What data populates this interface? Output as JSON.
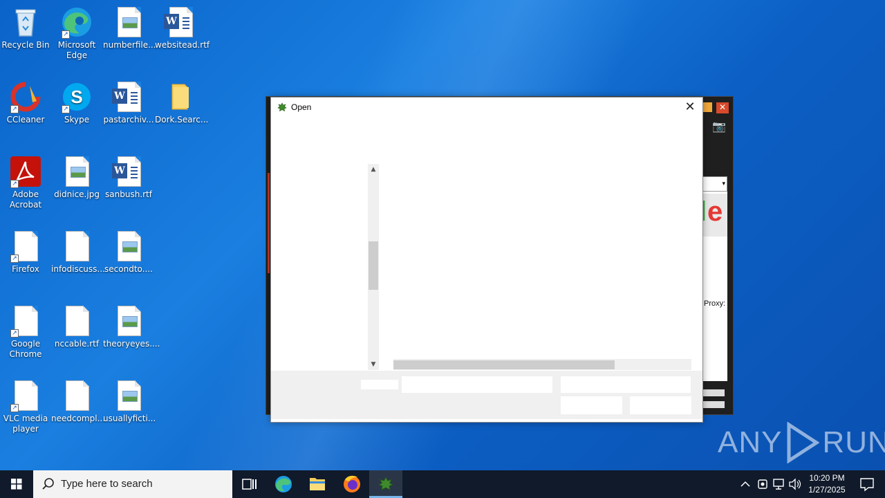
{
  "desktop": {
    "icons": [
      {
        "label": "Recycle Bin",
        "icon": "recycle-bin-icon"
      },
      {
        "label": "Microsoft Edge",
        "icon": "edge-icon"
      },
      {
        "label": "numberfile...",
        "icon": "image-file-icon"
      },
      {
        "label": "websitead.rtf",
        "icon": "word-doc-icon"
      },
      {
        "label": "CCleaner",
        "icon": "ccleaner-icon"
      },
      {
        "label": "Skype",
        "icon": "skype-icon"
      },
      {
        "label": "pastarchiv...",
        "icon": "word-doc-icon"
      },
      {
        "label": "Dork.Searc...",
        "icon": "folder-icon"
      },
      {
        "label": "Adobe Acrobat",
        "icon": "acrobat-icon"
      },
      {
        "label": "didnice.jpg",
        "icon": "image-file-icon"
      },
      {
        "label": "sanbush.rtf",
        "icon": "word-doc-icon"
      },
      {
        "label": "Firefox",
        "icon": "blank-file-icon"
      },
      {
        "label": "infodiscuss...",
        "icon": "blank-file-icon"
      },
      {
        "label": "secondto....",
        "icon": "image-file-icon"
      },
      {
        "label": "Google Chrome",
        "icon": "blank-file-icon"
      },
      {
        "label": "nccable.rtf",
        "icon": "blank-file-icon"
      },
      {
        "label": "theoryeyes....",
        "icon": "image-file-icon"
      },
      {
        "label": "VLC media player",
        "icon": "blank-file-icon"
      },
      {
        "label": "needcompl...",
        "icon": "blank-file-icon"
      },
      {
        "label": "usuallyficti...",
        "icon": "image-file-icon"
      }
    ]
  },
  "background_app": {
    "proxy_label": "Proxy:"
  },
  "dialog": {
    "title": "Open",
    "close_glyph": "✕"
  },
  "watermark": {
    "left": "ANY",
    "right": "RUN"
  },
  "taskbar": {
    "search_placeholder": "Type here to search",
    "time": "10:20 PM",
    "date": "1/27/2025"
  },
  "colors": {
    "desktop_blue": "#0a63c9",
    "taskbar": "#101a2a",
    "dialog_bottom": "#f0f0f0"
  }
}
